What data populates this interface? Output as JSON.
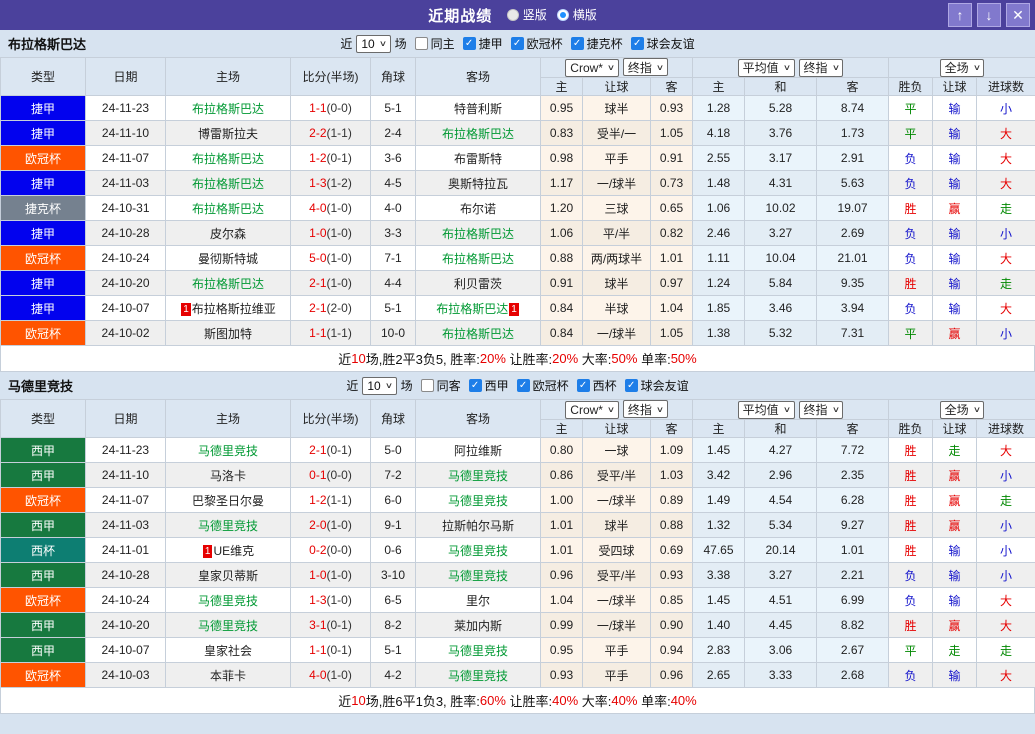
{
  "title_bar": {
    "title": "近期战绩",
    "radios": [
      {
        "label": "竖版",
        "selected": false
      },
      {
        "label": "横版",
        "selected": true
      }
    ]
  },
  "filter_bar": {
    "near_label": "近",
    "games_label": "场"
  },
  "table_header": {
    "main_cols": [
      "类型",
      "日期",
      "主场",
      "比分(半场)",
      "角球",
      "客场"
    ],
    "odds_select": "Crow*",
    "odds_time_select": "终指",
    "avg_select": "平均值",
    "avg_time_select": "终指",
    "scope_select": "全场",
    "sub_cols": [
      "主",
      "让球",
      "客",
      "主",
      "和",
      "客",
      "胜负",
      "让球",
      "进球数"
    ]
  },
  "type_colors": {
    "捷甲": "#0202EE",
    "欧冠杯": "#FF5400",
    "捷克杯": "#75818F",
    "西甲": "#17793F",
    "西杯": "#0D7E72"
  },
  "result_colors": {
    "胜": "#E60000",
    "平": "#008800",
    "负": "#1414CC",
    "赢": "#E60000",
    "输": "#1414CC",
    "走": "#008800",
    "大": "#E60000",
    "小": "#1414CC"
  },
  "highlight_color": "#009933",
  "sections": [
    {
      "team": "布拉格斯巴达",
      "games_value": "10",
      "same_checkbox": {
        "label": "同主",
        "checked": false
      },
      "filters": [
        {
          "label": "捷甲",
          "checked": true
        },
        {
          "label": "欧冠杯",
          "checked": true
        },
        {
          "label": "捷克杯",
          "checked": true
        },
        {
          "label": "球会友谊",
          "checked": true
        }
      ],
      "rows": [
        {
          "type": "捷甲",
          "date": "24-11-23",
          "home": "布拉格斯巴达",
          "home_hl": true,
          "score": "1-1",
          "half": "(0-0)",
          "corners": "5-1",
          "away": "特普利斯",
          "odds_home": "0.95",
          "handicap": "球半",
          "odds_away": "0.93",
          "avg_home": "1.28",
          "avg_draw": "5.28",
          "avg_away": "8.74",
          "res": [
            "平",
            "输",
            "小"
          ]
        },
        {
          "type": "捷甲",
          "date": "24-11-10",
          "home": "博雷斯拉夫",
          "score": "2-2",
          "half": "(1-1)",
          "corners": "2-4",
          "away": "布拉格斯巴达",
          "away_hl": true,
          "odds_home": "0.83",
          "handicap": "受半/一",
          "odds_away": "1.05",
          "avg_home": "4.18",
          "avg_draw": "3.76",
          "avg_away": "1.73",
          "res": [
            "平",
            "输",
            "大"
          ]
        },
        {
          "type": "欧冠杯",
          "date": "24-11-07",
          "home": "布拉格斯巴达",
          "home_hl": true,
          "score": "1-2",
          "half": "(0-1)",
          "corners": "3-6",
          "away": "布雷斯特",
          "odds_home": "0.98",
          "handicap": "平手",
          "odds_away": "0.91",
          "avg_home": "2.55",
          "avg_draw": "3.17",
          "avg_away": "2.91",
          "res": [
            "负",
            "输",
            "大"
          ]
        },
        {
          "type": "捷甲",
          "date": "24-11-03",
          "home": "布拉格斯巴达",
          "home_hl": true,
          "score": "1-3",
          "half": "(1-2)",
          "corners": "4-5",
          "away": "奥斯特拉瓦",
          "odds_home": "1.17",
          "handicap": "一/球半",
          "odds_away": "0.73",
          "avg_home": "1.48",
          "avg_draw": "4.31",
          "avg_away": "5.63",
          "res": [
            "负",
            "输",
            "大"
          ]
        },
        {
          "type": "捷克杯",
          "date": "24-10-31",
          "home": "布拉格斯巴达",
          "home_hl": true,
          "score": "4-0",
          "half": "(1-0)",
          "corners": "4-0",
          "away": "布尔诺",
          "odds_home": "1.20",
          "handicap": "三球",
          "odds_away": "0.65",
          "avg_home": "1.06",
          "avg_draw": "10.02",
          "avg_away": "19.07",
          "res": [
            "胜",
            "赢",
            "走"
          ]
        },
        {
          "type": "捷甲",
          "date": "24-10-28",
          "home": "皮尔森",
          "score": "1-0",
          "half": "(1-0)",
          "corners": "3-3",
          "away": "布拉格斯巴达",
          "away_hl": true,
          "odds_home": "1.06",
          "handicap": "平/半",
          "odds_away": "0.82",
          "avg_home": "2.46",
          "avg_draw": "3.27",
          "avg_away": "2.69",
          "res": [
            "负",
            "输",
            "小"
          ]
        },
        {
          "type": "欧冠杯",
          "date": "24-10-24",
          "home": "曼彻斯特城",
          "score": "5-0",
          "half": "(1-0)",
          "corners": "7-1",
          "away": "布拉格斯巴达",
          "away_hl": true,
          "odds_home": "0.88",
          "handicap": "两/两球半",
          "odds_away": "1.01",
          "avg_home": "1.11",
          "avg_draw": "10.04",
          "avg_away": "21.01",
          "res": [
            "负",
            "输",
            "大"
          ]
        },
        {
          "type": "捷甲",
          "date": "24-10-20",
          "home": "布拉格斯巴达",
          "home_hl": true,
          "score": "2-1",
          "half": "(1-0)",
          "corners": "4-4",
          "away": "利贝雷茨",
          "odds_home": "0.91",
          "handicap": "球半",
          "odds_away": "0.97",
          "avg_home": "1.24",
          "avg_draw": "5.84",
          "avg_away": "9.35",
          "res": [
            "胜",
            "输",
            "走"
          ]
        },
        {
          "type": "捷甲",
          "date": "24-10-07",
          "home": "布拉格斯拉维亚",
          "home_badge": "1",
          "score": "2-1",
          "half": "(2-0)",
          "corners": "5-1",
          "away": "布拉格斯巴达",
          "away_hl": true,
          "away_badge": "1",
          "odds_home": "0.84",
          "handicap": "半球",
          "odds_away": "1.04",
          "avg_home": "1.85",
          "avg_draw": "3.46",
          "avg_away": "3.94",
          "res": [
            "负",
            "输",
            "大"
          ]
        },
        {
          "type": "欧冠杯",
          "date": "24-10-02",
          "home": "斯图加特",
          "score": "1-1",
          "half": "(1-1)",
          "corners": "10-0",
          "away": "布拉格斯巴达",
          "away_hl": true,
          "odds_home": "0.84",
          "handicap": "一/球半",
          "odds_away": "1.05",
          "avg_home": "1.38",
          "avg_draw": "5.32",
          "avg_away": "7.31",
          "res": [
            "平",
            "赢",
            "小"
          ]
        }
      ],
      "summary_parts": [
        [
          "近",
          "k"
        ],
        [
          "10",
          "r"
        ],
        [
          "场,胜2平3负5, 胜率:",
          "k"
        ],
        [
          "20%",
          "r"
        ],
        [
          " 让胜率:",
          "k"
        ],
        [
          "20%",
          "r"
        ],
        [
          " 大率:",
          "k"
        ],
        [
          "50%",
          "r"
        ],
        [
          " 单率:",
          "k"
        ],
        [
          "50%",
          "r"
        ]
      ]
    },
    {
      "team": "马德里竞技",
      "games_value": "10",
      "same_checkbox": {
        "label": "同客",
        "checked": false
      },
      "filters": [
        {
          "label": "西甲",
          "checked": true
        },
        {
          "label": "欧冠杯",
          "checked": true
        },
        {
          "label": "西杯",
          "checked": true
        },
        {
          "label": "球会友谊",
          "checked": true
        }
      ],
      "rows": [
        {
          "type": "西甲",
          "date": "24-11-23",
          "home": "马德里竞技",
          "home_hl": true,
          "score": "2-1",
          "half": "(0-1)",
          "corners": "5-0",
          "away": "阿拉维斯",
          "odds_home": "0.80",
          "handicap": "一球",
          "odds_away": "1.09",
          "avg_home": "1.45",
          "avg_draw": "4.27",
          "avg_away": "7.72",
          "res": [
            "胜",
            "走",
            "大"
          ]
        },
        {
          "type": "西甲",
          "date": "24-11-10",
          "home": "马洛卡",
          "score": "0-1",
          "half": "(0-0)",
          "corners": "7-2",
          "away": "马德里竞技",
          "away_hl": true,
          "odds_home": "0.86",
          "handicap": "受平/半",
          "odds_away": "1.03",
          "avg_home": "3.42",
          "avg_draw": "2.96",
          "avg_away": "2.35",
          "res": [
            "胜",
            "赢",
            "小"
          ]
        },
        {
          "type": "欧冠杯",
          "date": "24-11-07",
          "home": "巴黎圣日尔曼",
          "score": "1-2",
          "half": "(1-1)",
          "corners": "6-0",
          "away": "马德里竞技",
          "away_hl": true,
          "odds_home": "1.00",
          "handicap": "一/球半",
          "odds_away": "0.89",
          "avg_home": "1.49",
          "avg_draw": "4.54",
          "avg_away": "6.28",
          "res": [
            "胜",
            "赢",
            "走"
          ]
        },
        {
          "type": "西甲",
          "date": "24-11-03",
          "home": "马德里竞技",
          "home_hl": true,
          "score": "2-0",
          "half": "(1-0)",
          "corners": "9-1",
          "away": "拉斯帕尔马斯",
          "odds_home": "1.01",
          "handicap": "球半",
          "odds_away": "0.88",
          "avg_home": "1.32",
          "avg_draw": "5.34",
          "avg_away": "9.27",
          "res": [
            "胜",
            "赢",
            "小"
          ]
        },
        {
          "type": "西杯",
          "date": "24-11-01",
          "home": "UE维克",
          "home_badge": "1",
          "score": "0-2",
          "half": "(0-0)",
          "corners": "0-6",
          "away": "马德里竞技",
          "away_hl": true,
          "odds_home": "1.01",
          "handicap": "受四球",
          "odds_away": "0.69",
          "avg_home": "47.65",
          "avg_draw": "20.14",
          "avg_away": "1.01",
          "res": [
            "胜",
            "输",
            "小"
          ]
        },
        {
          "type": "西甲",
          "date": "24-10-28",
          "home": "皇家贝蒂斯",
          "score": "1-0",
          "half": "(1-0)",
          "corners": "3-10",
          "away": "马德里竞技",
          "away_hl": true,
          "odds_home": "0.96",
          "handicap": "受平/半",
          "odds_away": "0.93",
          "avg_home": "3.38",
          "avg_draw": "3.27",
          "avg_away": "2.21",
          "res": [
            "负",
            "输",
            "小"
          ]
        },
        {
          "type": "欧冠杯",
          "date": "24-10-24",
          "home": "马德里竞技",
          "home_hl": true,
          "score": "1-3",
          "half": "(1-0)",
          "corners": "6-5",
          "away": "里尔",
          "odds_home": "1.04",
          "handicap": "一/球半",
          "odds_away": "0.85",
          "avg_home": "1.45",
          "avg_draw": "4.51",
          "avg_away": "6.99",
          "res": [
            "负",
            "输",
            "大"
          ]
        },
        {
          "type": "西甲",
          "date": "24-10-20",
          "home": "马德里竞技",
          "home_hl": true,
          "score": "3-1",
          "half": "(0-1)",
          "corners": "8-2",
          "away": "莱加内斯",
          "odds_home": "0.99",
          "handicap": "一/球半",
          "odds_away": "0.90",
          "avg_home": "1.40",
          "avg_draw": "4.45",
          "avg_away": "8.82",
          "res": [
            "胜",
            "赢",
            "大"
          ]
        },
        {
          "type": "西甲",
          "date": "24-10-07",
          "home": "皇家社会",
          "score": "1-1",
          "half": "(0-1)",
          "corners": "5-1",
          "away": "马德里竞技",
          "away_hl": true,
          "odds_home": "0.95",
          "handicap": "平手",
          "odds_away": "0.94",
          "avg_home": "2.83",
          "avg_draw": "3.06",
          "avg_away": "2.67",
          "res": [
            "平",
            "走",
            "走"
          ]
        },
        {
          "type": "欧冠杯",
          "date": "24-10-03",
          "home": "本菲卡",
          "score": "4-0",
          "half": "(1-0)",
          "corners": "4-2",
          "away": "马德里竞技",
          "away_hl": true,
          "odds_home": "0.93",
          "handicap": "平手",
          "odds_away": "0.96",
          "avg_home": "2.65",
          "avg_draw": "3.33",
          "avg_away": "2.68",
          "res": [
            "负",
            "输",
            "大"
          ]
        }
      ],
      "summary_parts": [
        [
          "近",
          "k"
        ],
        [
          "10",
          "r"
        ],
        [
          "场,胜6平1负3, 胜率:",
          "k"
        ],
        [
          "60%",
          "r"
        ],
        [
          " 让胜率:",
          "k"
        ],
        [
          "40%",
          "r"
        ],
        [
          " 大率:",
          "k"
        ],
        [
          "40%",
          "r"
        ],
        [
          " 单率:",
          "k"
        ],
        [
          "40%",
          "r"
        ]
      ]
    }
  ]
}
